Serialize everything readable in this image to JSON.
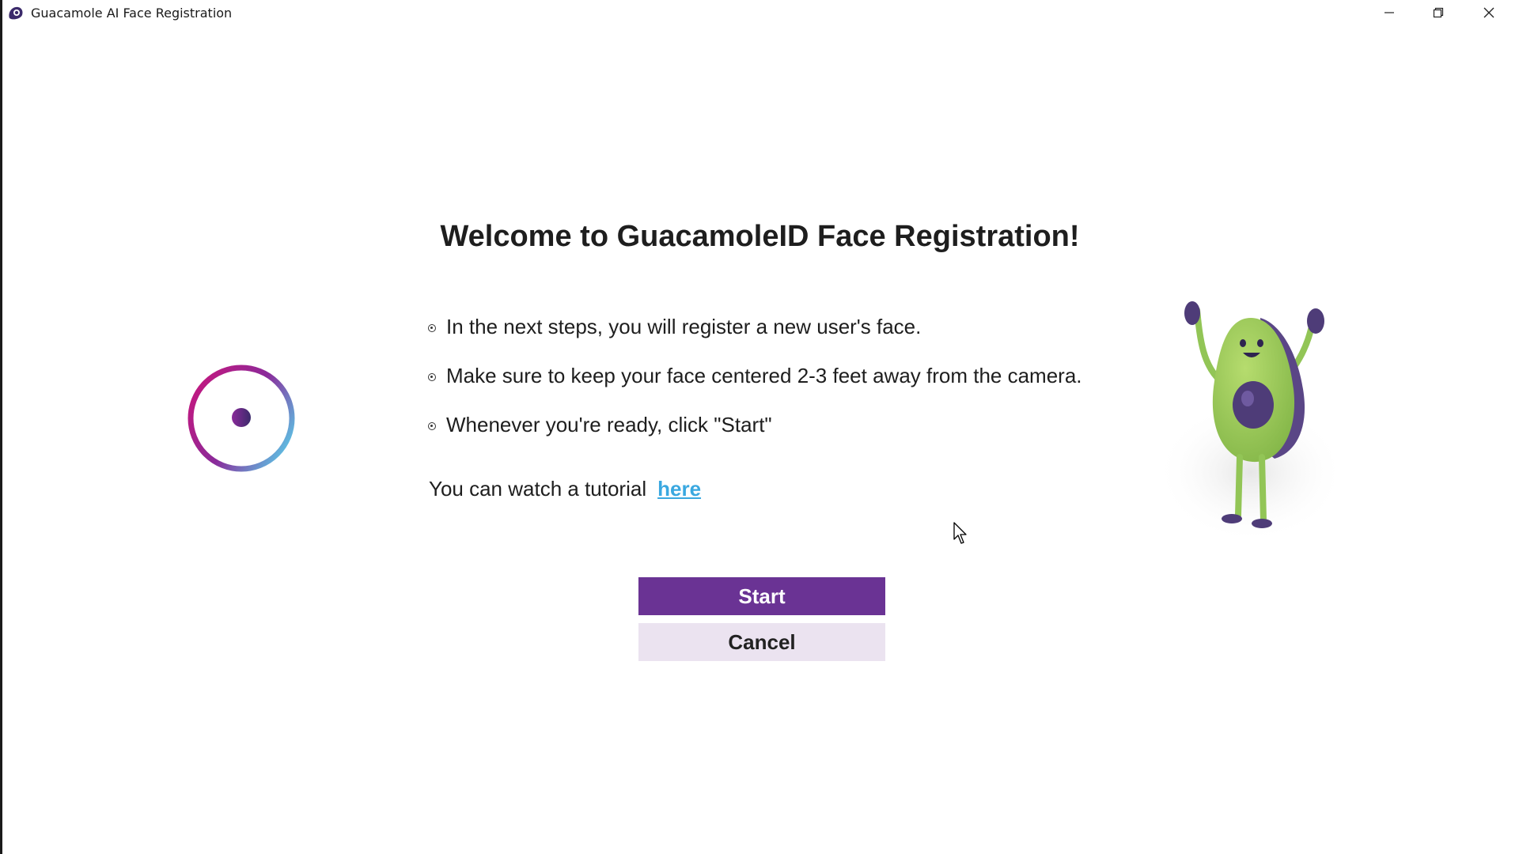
{
  "window": {
    "title": "Guacamole AI Face Registration",
    "accent_color": "#6a3394",
    "link_color": "#3aa8e0",
    "controls": [
      "minimize-icon",
      "restore-icon",
      "close-icon"
    ]
  },
  "main": {
    "heading": "Welcome to GuacamoleID Face Registration!",
    "bullets": [
      "In the next steps, you will register a new user's face.",
      "Make sure to keep your face centered 2-3 feet away from the camera.",
      "Whenever you're ready, click \"Start\""
    ],
    "tutorial_text": "You can watch a tutorial",
    "tutorial_link": "here",
    "start_label": "Start",
    "cancel_label": "Cancel"
  },
  "icons": {
    "app": "guacamole-logo-icon",
    "spinner": "loading-spinner-icon",
    "mascot": "avocado-mascot-icon",
    "cursor": "mouse-pointer-icon"
  }
}
